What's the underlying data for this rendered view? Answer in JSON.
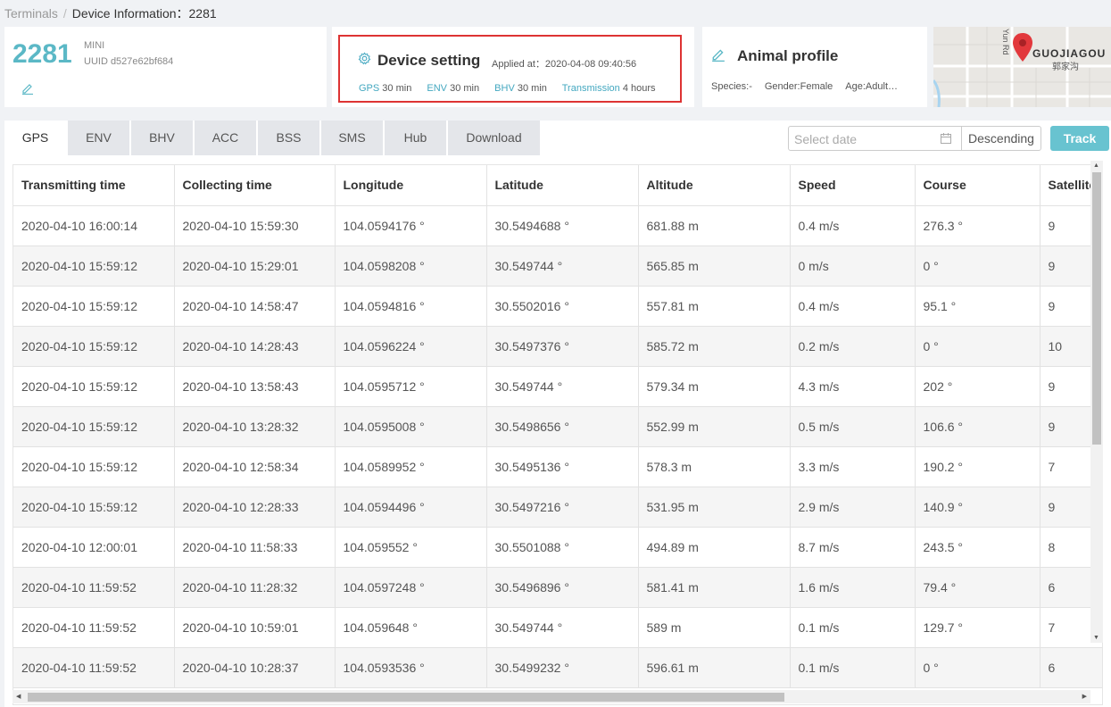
{
  "breadcrumb": {
    "root": "Terminals",
    "separator": "/",
    "current": "Device Information：2281"
  },
  "device": {
    "id": "2281",
    "model": "MINI",
    "uuid": "UUID d527e62bf684"
  },
  "device_setting": {
    "title": "Device setting",
    "applied": "Applied at：2020-04-08 09:40:56",
    "items": [
      {
        "key": "GPS",
        "value": "30 min"
      },
      {
        "key": "ENV",
        "value": "30 min"
      },
      {
        "key": "BHV",
        "value": "30 min"
      },
      {
        "key": "Transmission",
        "value": "4 hours"
      }
    ]
  },
  "animal": {
    "title": "Animal profile",
    "species": "Species:-",
    "gender": "Gender:Female",
    "age": "Age:Adult…"
  },
  "map": {
    "label_en": "GUOJIAGOU",
    "label_cn": "郭家沟",
    "road": "Yun Rd"
  },
  "tabs": [
    "GPS",
    "ENV",
    "BHV",
    "ACC",
    "BSS",
    "SMS",
    "Hub",
    "Download"
  ],
  "controls": {
    "date_placeholder": "Select date",
    "order": "Descending",
    "track": "Track"
  },
  "table": {
    "headers": [
      "Transmitting time",
      "Collecting time",
      "Longitude",
      "Latitude",
      "Altitude",
      "Speed",
      "Course",
      "Satellite"
    ],
    "rows": [
      [
        "2020-04-10 16:00:14",
        "2020-04-10 15:59:30",
        "104.0594176 °",
        "30.5494688 °",
        "681.88 m",
        "0.4 m/s",
        "276.3 °",
        "9"
      ],
      [
        "2020-04-10 15:59:12",
        "2020-04-10 15:29:01",
        "104.0598208 °",
        "30.549744 °",
        "565.85 m",
        "0 m/s",
        "0 °",
        "9"
      ],
      [
        "2020-04-10 15:59:12",
        "2020-04-10 14:58:47",
        "104.0594816 °",
        "30.5502016 °",
        "557.81 m",
        "0.4 m/s",
        "95.1 °",
        "9"
      ],
      [
        "2020-04-10 15:59:12",
        "2020-04-10 14:28:43",
        "104.0596224 °",
        "30.5497376 °",
        "585.72 m",
        "0.2 m/s",
        "0 °",
        "10"
      ],
      [
        "2020-04-10 15:59:12",
        "2020-04-10 13:58:43",
        "104.0595712 °",
        "30.549744 °",
        "579.34 m",
        "4.3 m/s",
        "202 °",
        "9"
      ],
      [
        "2020-04-10 15:59:12",
        "2020-04-10 13:28:32",
        "104.0595008 °",
        "30.5498656 °",
        "552.99 m",
        "0.5 m/s",
        "106.6 °",
        "9"
      ],
      [
        "2020-04-10 15:59:12",
        "2020-04-10 12:58:34",
        "104.0589952 °",
        "30.5495136 °",
        "578.3 m",
        "3.3 m/s",
        "190.2 °",
        "7"
      ],
      [
        "2020-04-10 15:59:12",
        "2020-04-10 12:28:33",
        "104.0594496 °",
        "30.5497216 °",
        "531.95 m",
        "2.9 m/s",
        "140.9 °",
        "9"
      ],
      [
        "2020-04-10 12:00:01",
        "2020-04-10 11:58:33",
        "104.059552 °",
        "30.5501088 °",
        "494.89 m",
        "8.7 m/s",
        "243.5 °",
        "8"
      ],
      [
        "2020-04-10 11:59:52",
        "2020-04-10 11:28:32",
        "104.0597248 °",
        "30.5496896 °",
        "581.41 m",
        "1.6 m/s",
        "79.4 °",
        "6"
      ],
      [
        "2020-04-10 11:59:52",
        "2020-04-10 10:59:01",
        "104.059648 °",
        "30.549744 °",
        "589 m",
        "0.1 m/s",
        "129.7 °",
        "7"
      ],
      [
        "2020-04-10 11:59:52",
        "2020-04-10 10:28:37",
        "104.0593536 °",
        "30.5499232 °",
        "596.61 m",
        "0.1 m/s",
        "0 °",
        "6"
      ]
    ]
  },
  "colors": {
    "accent": "#5bb8c6",
    "highlight_border": "#dd3333",
    "marker": "#e2383c"
  }
}
